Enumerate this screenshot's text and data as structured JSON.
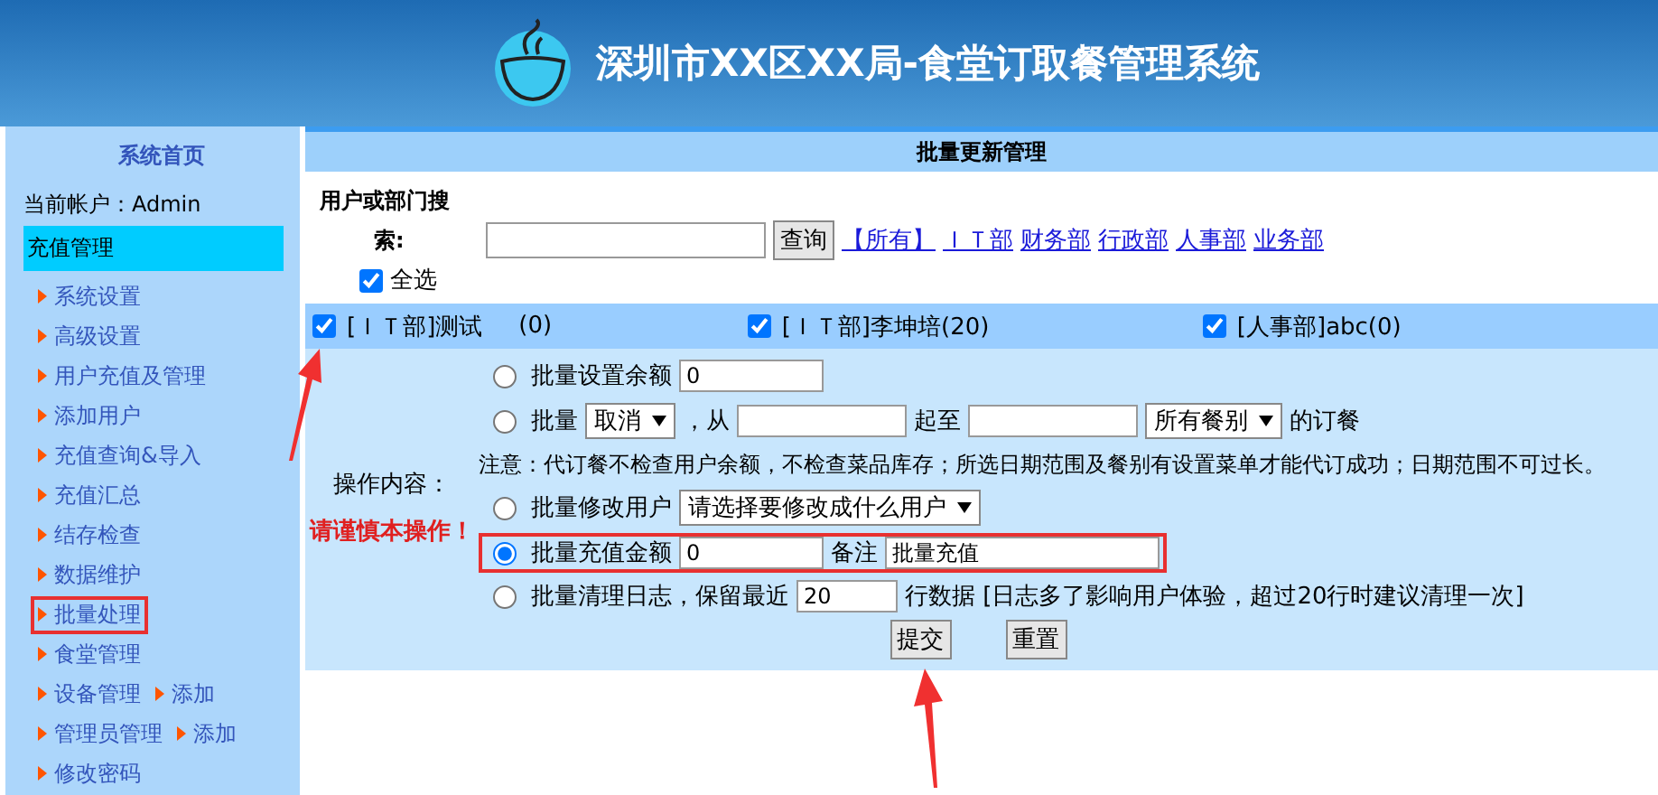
{
  "header": {
    "title": "深圳市XX区XX局-食堂订取餐管理系统"
  },
  "sidebar": {
    "home": "系统首页",
    "account": "当前帐户：Admin",
    "section": "充值管理",
    "items": [
      {
        "label": "系统设置",
        "highlighted": false
      },
      {
        "label": "高级设置",
        "highlighted": false
      },
      {
        "label": "用户充值及管理",
        "highlighted": false
      },
      {
        "label": "添加用户",
        "highlighted": false
      },
      {
        "label": "充值查询&导入",
        "highlighted": false
      },
      {
        "label": "充值汇总",
        "highlighted": false
      },
      {
        "label": "结存检查",
        "highlighted": false
      },
      {
        "label": "数据维护",
        "highlighted": false
      },
      {
        "label": "批量处理",
        "highlighted": true
      },
      {
        "label": "食堂管理",
        "highlighted": false
      },
      {
        "label": "设备管理",
        "extra": "添加",
        "highlighted": false
      },
      {
        "label": "管理员管理",
        "extra": "添加",
        "highlighted": false
      },
      {
        "label": "修改密码",
        "highlighted": false
      }
    ]
  },
  "panel": {
    "title": "批量更新管理",
    "search": {
      "label_top": "用户或部门搜",
      "label_bottom": "索:",
      "button": "查询",
      "links": [
        "【所有】",
        "ＩＴ部",
        "财务部",
        "行政部",
        "人事部",
        "业务部"
      ],
      "select_all": {
        "label": "全选",
        "checked": true
      }
    },
    "users": [
      {
        "label": "[ＩＴ部]测试",
        "count": "(0)",
        "checked": true
      },
      {
        "label": "[ＩＴ部]李坤培(20)",
        "checked": true
      },
      {
        "label": "[人事部]abc(0)",
        "checked": true
      }
    ],
    "ops_label": "操作内容：",
    "warning": "请谨慎本操作！",
    "operations": [
      {
        "kind": "amount",
        "selected": false,
        "highlighted": false,
        "label": "批量设置余额",
        "value": "0"
      },
      {
        "kind": "order",
        "selected": false,
        "highlighted": false,
        "label": "批量",
        "action": "取消",
        "from": "，从",
        "to": "起至",
        "meal": "所有餐别",
        "suffix": "的订餐",
        "note": "注意：代订餐不检查用户余额，不检查菜品库存；所选日期范围及餐别有设置菜单才能代订成功；日期范围不可过长。"
      },
      {
        "kind": "user",
        "selected": false,
        "highlighted": false,
        "label": "批量修改用户",
        "choice": "请选择要修改成什么用户"
      },
      {
        "kind": "recharge",
        "selected": true,
        "highlighted": true,
        "label": "批量充值金额",
        "value": "0",
        "remark_label": "备注",
        "remark": "批量充值"
      },
      {
        "kind": "log",
        "selected": false,
        "highlighted": false,
        "label": "批量清理日志，保留最近",
        "value": "20",
        "suffix": "行数据 [日志多了影响用户体验，超过20行时建议清理一次]"
      }
    ],
    "buttons": [
      "提交",
      "重置"
    ]
  }
}
